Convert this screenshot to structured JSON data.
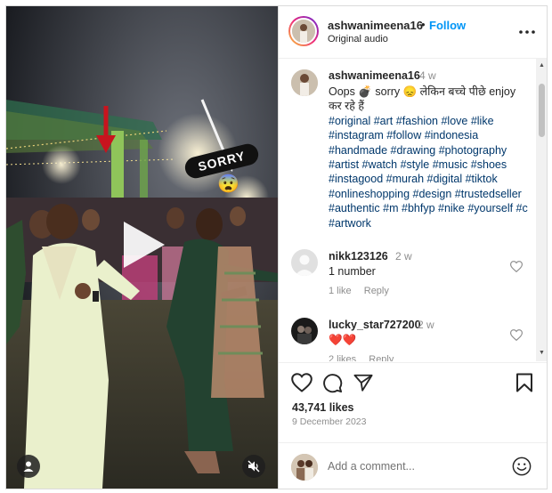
{
  "post": {
    "username": "ashwanimeena16",
    "separator": "•",
    "follow_label": "Follow",
    "audio_label": "Original audio"
  },
  "media": {
    "overlay_text": "SORRY",
    "overlay_emoji": "😨",
    "play_icon": "play-icon",
    "user_tag_icon": "user-icon",
    "mute_icon": "speaker-muted-icon"
  },
  "caption": {
    "username": "ashwanimeena16",
    "time": "4 w",
    "text": "Oops 💣 sorry 😞 लेकिन बच्चे पीछे enjoy कर रहे हैं",
    "hashtags": "#original #art #fashion #love #like #instagram #follow #indonesia #handmade #drawing #photography #artist #watch #style #music #shoes #instagood #murah #digital #tiktok #onlineshopping #design #trustedseller #authentic #m #bhfyp #nike #yourself #c #artwork"
  },
  "comments": [
    {
      "username": "nikk123126",
      "time": "2 w",
      "text": "1 number",
      "likes": "1 like",
      "reply": "Reply"
    },
    {
      "username": "lucky_star727200",
      "time": "2 w",
      "text": "❤️❤️",
      "likes": "2 likes",
      "reply": "Reply"
    }
  ],
  "engagement": {
    "likes": "43,741 likes",
    "date": "9 December 2023"
  },
  "composer": {
    "placeholder": "Add a comment..."
  },
  "colors": {
    "accent": "#0095f6",
    "text": "#262626",
    "muted": "#8e8e8e",
    "hashtag": "#00376b",
    "border": "#dbdbdb"
  }
}
